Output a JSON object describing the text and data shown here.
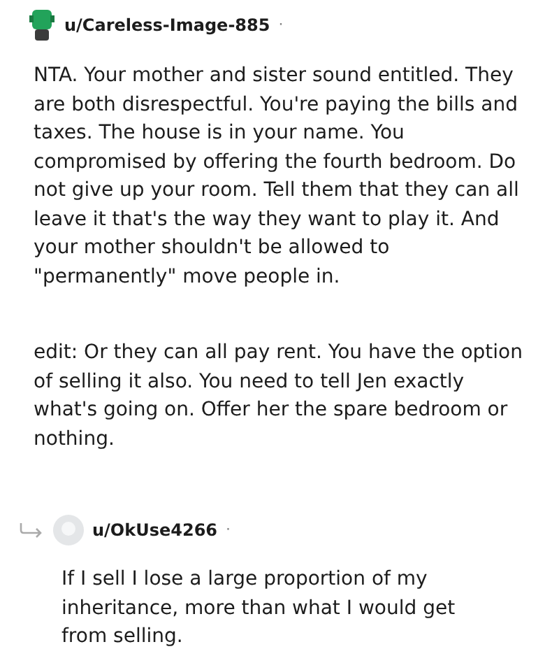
{
  "comment": {
    "username": "u/Careless-Image-885",
    "separator": "·",
    "paragraphs": [
      "NTA. Your mother and sister sound entitled. They are both disrespectful. You're paying the bills and taxes. The house is in your name. You compromised by offering the fourth bedroom. Do not give up your room. Tell them that they can all leave it that's the way they want to play it. And your mother shouldn't be allowed to \"permanently\" move people in.",
      "edit: Or they can all pay rent. You have the option of selling it also. You need to tell Jen exactly what's going on. Offer her the spare bedroom or nothing."
    ]
  },
  "reply": {
    "username": "u/OkUse4266",
    "separator": "·",
    "paragraphs": [
      "If I sell I lose a large proportion of my inheritance, more than what I would get from selling."
    ]
  }
}
